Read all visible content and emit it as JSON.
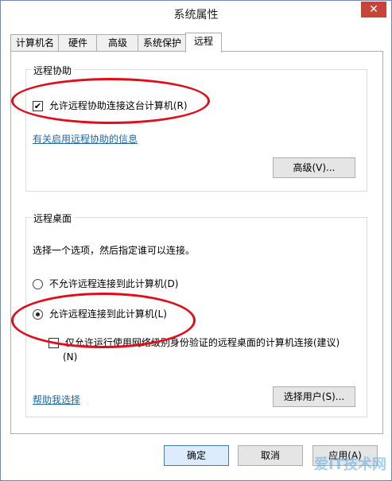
{
  "window": {
    "title": "系统属性",
    "close_glyph": "✕"
  },
  "tabs": [
    {
      "label": "计算机名"
    },
    {
      "label": "硬件"
    },
    {
      "label": "高级"
    },
    {
      "label": "系统保护"
    },
    {
      "label": "远程",
      "active": true
    }
  ],
  "remote_assistance": {
    "group_title": "远程协助",
    "allow_checkbox": {
      "label": "允许远程协助连接这台计算机(R)",
      "checked": true
    },
    "info_link": "有关启用远程协助的信息",
    "advanced_button": "高级(V)..."
  },
  "remote_desktop": {
    "group_title": "远程桌面",
    "instruction": "选择一个选项，然后指定谁可以连接。",
    "option_disallow": {
      "label": "不允许远程连接到此计算机(D)",
      "checked": false
    },
    "option_allow": {
      "label": "允许远程连接到此计算机(L)",
      "checked": true
    },
    "nla_checkbox": {
      "label_line1": "仅允许运行使用网络级别身份验证的远程桌面的计算机连接(建议)",
      "label_line2": "(N)",
      "checked": false
    },
    "help_link": "帮助我选择",
    "select_users_button": "选择用户(S)..."
  },
  "footer": {
    "ok_button": "确定",
    "cancel_button": "取消",
    "apply_button": "应用(A)"
  },
  "watermark": "爱IT技术网",
  "colors": {
    "annotation_ellipse": "#e00e1a",
    "link": "#1d6aa8",
    "close_button": "#c7443a"
  }
}
